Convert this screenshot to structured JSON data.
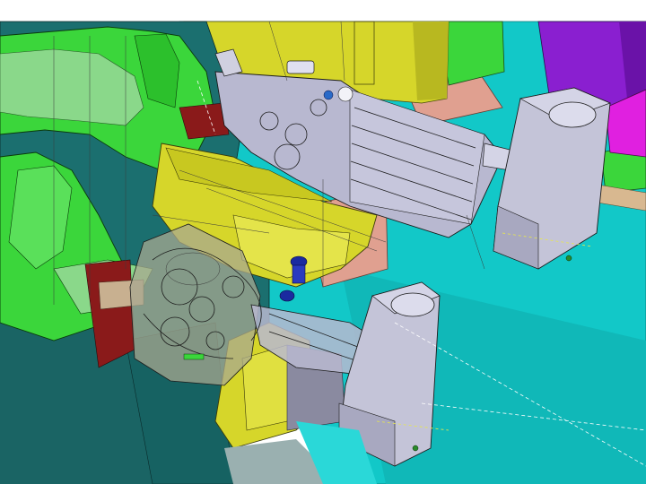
{
  "viewport": {
    "background": "#ffffff",
    "mode": "3d-cad-wireframe-shaded"
  },
  "colors": {
    "cyan_plate": "#12c8c8",
    "cyan_dark": "#0f9d9d",
    "teal_block": "#1b6f6f",
    "green_body": "#3bd63b",
    "green_dark": "#1e9a1e",
    "yellow_clamp": "#d6d62a",
    "yellow_dark": "#a8a81a",
    "purple_block": "#8a1fd0",
    "magenta_block": "#e020e0",
    "salmon_plate": "#e0a090",
    "steel_cylinder": "#b8b8d0",
    "steel_light": "#d4d4e6",
    "dark_red": "#8a1a1a",
    "blue_fitting": "#1a2aa0"
  },
  "parts": [
    {
      "name": "base-plate",
      "color": "cyan_plate"
    },
    {
      "name": "clamp-body-left",
      "color": "green_body"
    },
    {
      "name": "clamp-arm-upper",
      "color": "yellow_clamp"
    },
    {
      "name": "clamp-arm-lower",
      "color": "yellow_clamp"
    },
    {
      "name": "pneumatic-cylinder-upper",
      "color": "steel_cylinder"
    },
    {
      "name": "pneumatic-cylinder-lower",
      "color": "steel_cylinder"
    },
    {
      "name": "pivot-block-upper",
      "color": "steel_light"
    },
    {
      "name": "pivot-block-lower",
      "color": "steel_light"
    },
    {
      "name": "locator-block-purple",
      "color": "purple_block"
    },
    {
      "name": "locator-block-magenta",
      "color": "magenta_block"
    },
    {
      "name": "air-fitting",
      "color": "blue_fitting"
    }
  ]
}
